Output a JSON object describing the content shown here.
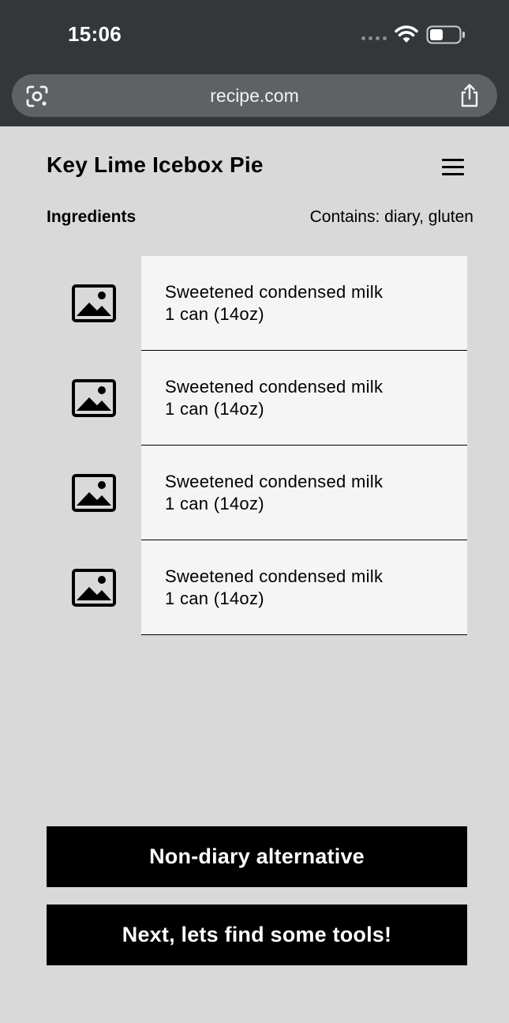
{
  "status_bar": {
    "time": "15:06"
  },
  "browser": {
    "url": "recipe.com",
    "icons": {
      "lens": "camera-lens-icon",
      "share": "share-icon"
    }
  },
  "header": {
    "title": "Key Lime Icebox Pie",
    "menu_icon": "hamburger-menu-icon"
  },
  "ingredients_section": {
    "label": "Ingredients",
    "allergens": "Contains: diary, gluten",
    "items": [
      {
        "name": "Sweetened condensed milk",
        "quantity": "1 can (14oz)",
        "icon": "image-placeholder-icon"
      },
      {
        "name": "Sweetened condensed milk",
        "quantity": "1 can (14oz)",
        "icon": "image-placeholder-icon"
      },
      {
        "name": "Sweetened condensed milk",
        "quantity": "1 can (14oz)",
        "icon": "image-placeholder-icon"
      },
      {
        "name": "Sweetened condensed milk",
        "quantity": "1 can (14oz)",
        "icon": "image-placeholder-icon"
      }
    ]
  },
  "actions": {
    "alternative_label": "Non-diary alternative",
    "next_label": "Next, lets find some tools!"
  },
  "colors": {
    "page_background": "#d9d9d9",
    "chrome_background": "#33373a",
    "url_bar": "#5e6265",
    "card_background": "#f5f5f5",
    "button_background": "#000000",
    "button_text": "#ffffff"
  }
}
